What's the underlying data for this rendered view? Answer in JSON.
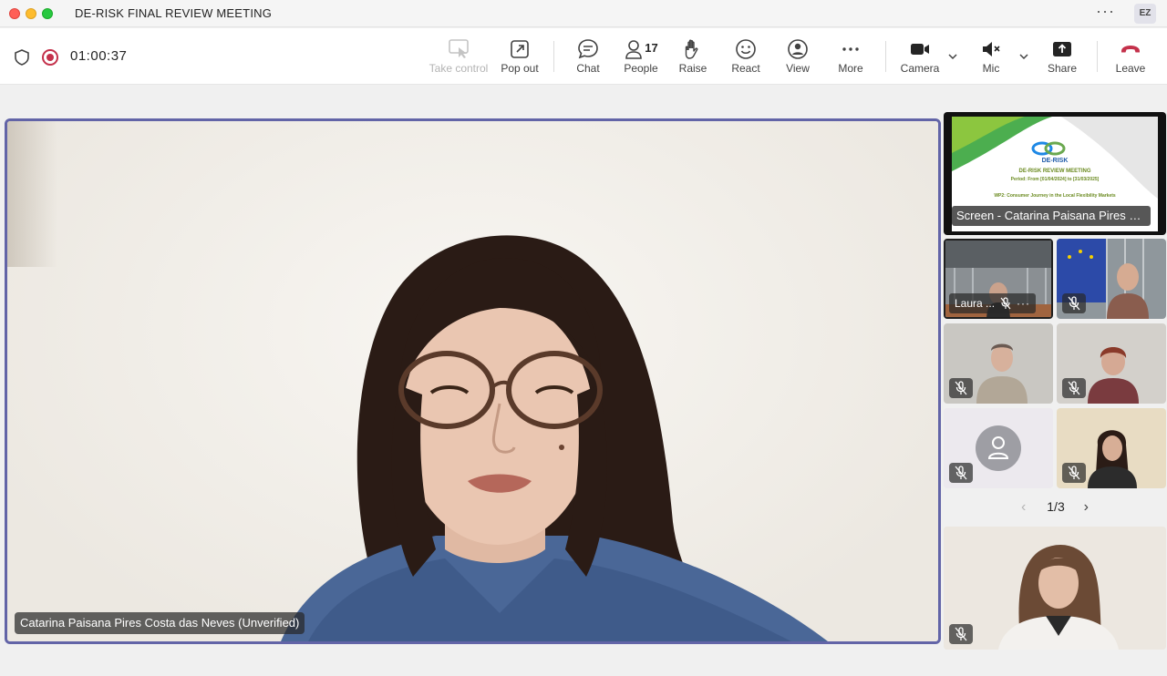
{
  "window": {
    "title": "DE-RISK FINAL REVIEW MEETING",
    "avatar_initials": "EZ",
    "more_glyph": "···"
  },
  "toolbar": {
    "timer": "01:00:37",
    "take_control": "Take control",
    "pop_out": "Pop out",
    "chat": "Chat",
    "people": "People",
    "people_count": "17",
    "raise": "Raise",
    "react": "React",
    "view": "View",
    "more": "More",
    "camera": "Camera",
    "mic": "Mic",
    "share": "Share",
    "leave": "Leave"
  },
  "main_video": {
    "name": "Catarina Paisana Pires Costa das Neves (Unverified)"
  },
  "screen_share": {
    "label": "Screen - Catarina Paisana Pires C...",
    "slide_logo": "DE-RISK",
    "slide_title": "DE-RISK REVIEW MEETING",
    "slide_period": "Period: From [01/04/2024] to [31/03/2025]",
    "slide_wp": "WP2: Consumer Journey in the Local Flexibility Markets"
  },
  "participants": [
    {
      "name": "Laura ...",
      "more": "···",
      "muted": true
    }
  ],
  "pager": {
    "label": "1/3",
    "prev": "‹",
    "next": "›"
  },
  "colors": {
    "accent": "#6264a7",
    "recording": "#c4314b",
    "leave": "#c4314b"
  }
}
